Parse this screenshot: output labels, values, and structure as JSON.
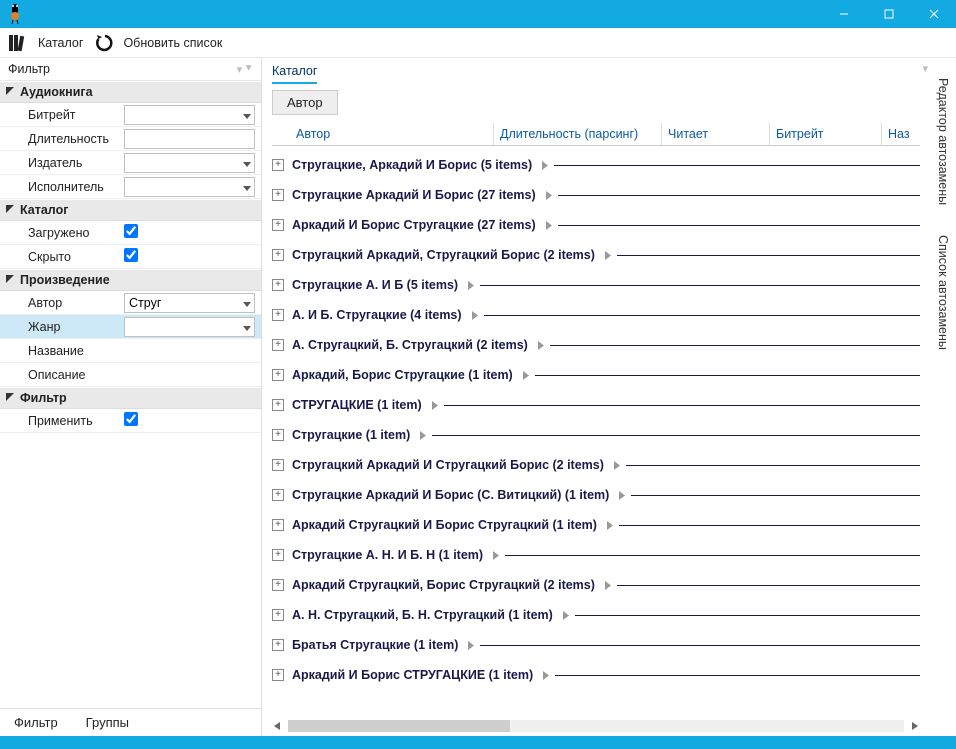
{
  "toolbar": {
    "catalog": "Каталог",
    "refresh": "Обновить список"
  },
  "leftPanel": {
    "title": "Фильтр",
    "tabs": {
      "filter": "Фильтр",
      "groups": "Группы"
    },
    "groups": {
      "audiobook": {
        "title": "Аудиокнига",
        "bitrate": "Битрейт",
        "duration": "Длительность",
        "publisher": "Издатель",
        "performer": "Исполнитель"
      },
      "catalog": {
        "title": "Каталог",
        "loaded": "Загружено",
        "hidden": "Скрыто"
      },
      "work": {
        "title": "Произведение",
        "author": "Автор",
        "author_value": "Струг",
        "genre": "Жанр",
        "name": "Название",
        "description": "Описание"
      },
      "filter": {
        "title": "Фильтр",
        "apply": "Применить"
      }
    }
  },
  "center": {
    "title": "Каталог",
    "subtab": "Автор",
    "columns": {
      "author": "Автор",
      "duration": "Длительность (парсинг)",
      "reader": "Читает",
      "bitrate": "Битрейт",
      "name": "Наз"
    },
    "groups": [
      {
        "label": "Стругацкие, Аркадий И Борис (5 items)"
      },
      {
        "label": "Стругацкие Аркадий И Борис (27 items)"
      },
      {
        "label": "Аркадий И Борис Стругацкие (27 items)"
      },
      {
        "label": "Стругацкий Аркадий, Стругацкий Борис (2 items)"
      },
      {
        "label": "Стругацкие А. И Б (5 items)"
      },
      {
        "label": "А. И Б. Стругацкие (4 items)"
      },
      {
        "label": "А. Стругацкий, Б. Стругацкий (2 items)"
      },
      {
        "label": "Аркадий, Борис Стругацкие (1 item)"
      },
      {
        "label": "СТРУГАЦКИЕ (1 item)"
      },
      {
        "label": "Стругацкие (1 item)"
      },
      {
        "label": "Стругацкий Аркадий И Стругацкий Борис (2 items)"
      },
      {
        "label": "Стругацкие Аркадий И Борис (С. Витицкий) (1 item)"
      },
      {
        "label": "Аркадий Стругацкий И Борис Стругацкий (1 item)"
      },
      {
        "label": "Стругацкие А. Н. И Б. Н (1 item)"
      },
      {
        "label": "Аркадий Стругацкий, Борис Стругацкий (2 items)"
      },
      {
        "label": "А. Н. Стругацкий, Б. Н. Стругацкий (1 item)"
      },
      {
        "label": "Братья Стругацкие (1 item)"
      },
      {
        "label": "Аркадий И Борис СТРУГАЦКИЕ (1 item)"
      }
    ]
  },
  "rightPanel": {
    "tab1": "Редактор автозамены",
    "tab2": "Список автозамены"
  }
}
